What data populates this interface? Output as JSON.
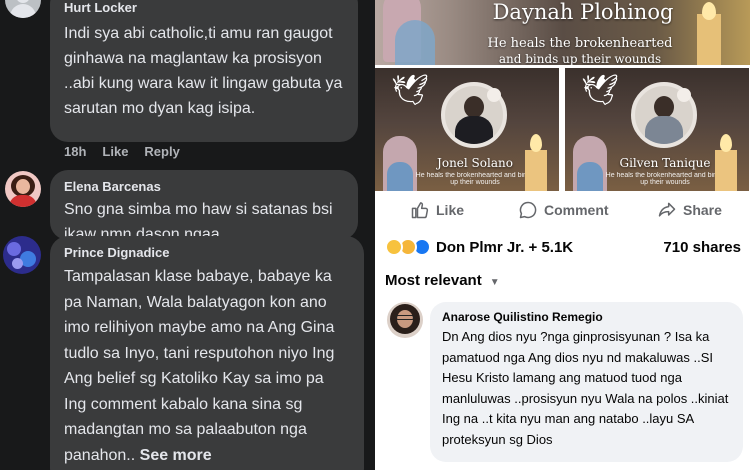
{
  "left_panel": {
    "comments": [
      {
        "author": "Hurt Locker",
        "text": "Indi sya abi catholic,ti amu ran gaugot ginhawa na maglantaw ka prosisyon ..abi kung wara kaw it lingaw gabuta ya sarutan mo dyan kag isipa.",
        "time": "18h",
        "like_label": "Like",
        "reply_label": "Reply"
      },
      {
        "author": "Elena Barcenas",
        "text": "Sno gna simba mo haw si satanas bsi ikaw nmn dason ngaa"
      },
      {
        "author": "Prince Dignadice",
        "text": "Tampalasan klase babaye, babaye ka pa Naman, Wala balatyagon kon ano imo relihiyon maybe amo na Ang Gina tudlo sa Inyo, tani resputohon niyo Ing Ang belief sg Katoliko Kay sa imo pa Ing comment kabalo kana sina sg madangtan mo sa palaabuton nga panahon..",
        "see_more": "See more"
      }
    ]
  },
  "post": {
    "top_image": {
      "name": "Daynah Plohinog",
      "line1": "He heals the brokenhearted",
      "line2": "and binds up their wounds"
    },
    "memorials": [
      {
        "name": "Jonel Solano",
        "small_text": "He heals the brokenhearted and binds up their wounds"
      },
      {
        "name": "Gilven Tanique",
        "small_text": "He heals the brokenhearted and binds up their wounds"
      }
    ],
    "actions": {
      "like": "Like",
      "comment": "Comment",
      "share": "Share"
    },
    "reactions_label": "Don Plmr Jr. + 5.1K",
    "shares_label": "710 shares",
    "sort_label": "Most relevant",
    "colors": {
      "like_blue": "#1877f2",
      "dark_bg": "#18191a",
      "bubble_dark": "#3a3b3c",
      "bubble_light": "#f0f2f5"
    }
  },
  "right_comment": {
    "author": "Anarose Quilistino Remegio",
    "text": "Dn Ang dios nyu ?nga ginprosisyunan ? Isa ka pamatuod nga Ang dios nyu nd makaluwas ..SI Hesu Kristo lamang ang matuod tuod nga manluluwas ..prosisyun nyu Wala na polos ..kiniat Ing na ..t kita nyu man ang natabo ..layu SA proteksyun sg Dios"
  }
}
